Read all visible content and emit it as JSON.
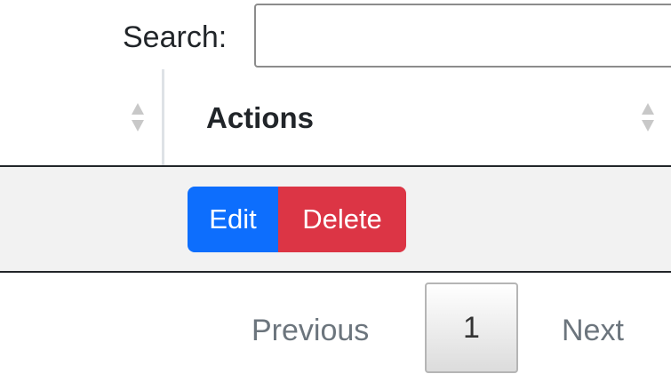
{
  "search": {
    "label": "Search:",
    "value": ""
  },
  "table": {
    "headers": [
      {
        "label": ""
      },
      {
        "label": "Actions"
      }
    ],
    "rows": [
      {
        "actions": {
          "edit_label": "Edit",
          "delete_label": "Delete"
        }
      }
    ]
  },
  "pagination": {
    "previous_label": "Previous",
    "current_page": "1",
    "next_label": "Next"
  },
  "colors": {
    "edit_button": "#0d6efd",
    "delete_button": "#dc3545",
    "row_stripe": "#f2f2f2"
  },
  "icons": [
    "sort-both-icon"
  ]
}
